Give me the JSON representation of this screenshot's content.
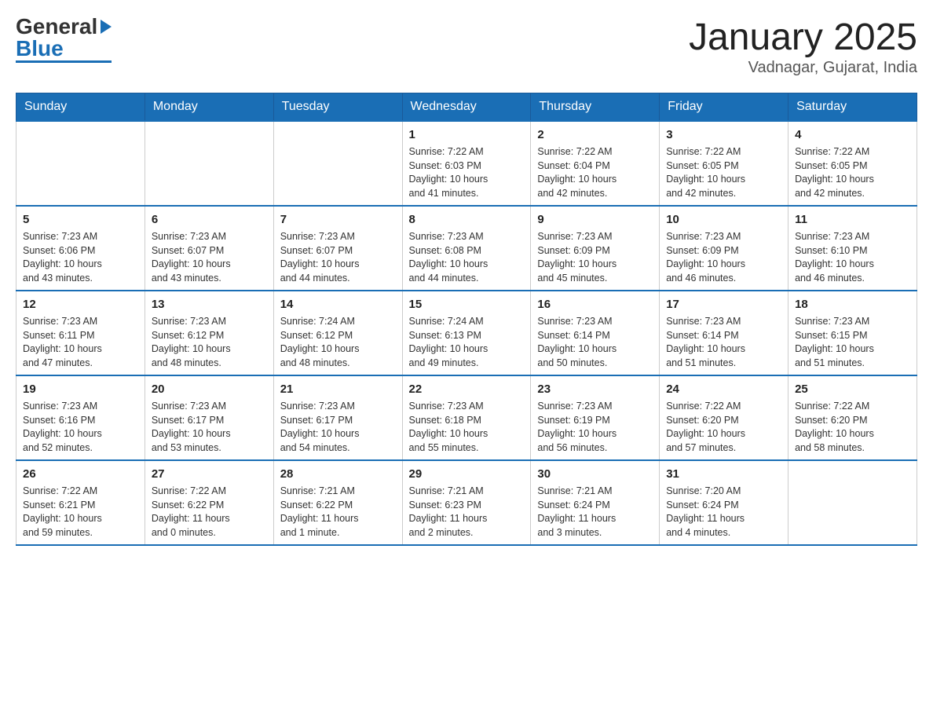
{
  "header": {
    "logo": {
      "general": "General",
      "blue": "Blue",
      "tagline": ""
    },
    "title": "January 2025",
    "location": "Vadnagar, Gujarat, India"
  },
  "calendar": {
    "days": [
      "Sunday",
      "Monday",
      "Tuesday",
      "Wednesday",
      "Thursday",
      "Friday",
      "Saturday"
    ],
    "weeks": [
      [
        {
          "num": "",
          "info": ""
        },
        {
          "num": "",
          "info": ""
        },
        {
          "num": "",
          "info": ""
        },
        {
          "num": "1",
          "info": "Sunrise: 7:22 AM\nSunset: 6:03 PM\nDaylight: 10 hours\nand 41 minutes."
        },
        {
          "num": "2",
          "info": "Sunrise: 7:22 AM\nSunset: 6:04 PM\nDaylight: 10 hours\nand 42 minutes."
        },
        {
          "num": "3",
          "info": "Sunrise: 7:22 AM\nSunset: 6:05 PM\nDaylight: 10 hours\nand 42 minutes."
        },
        {
          "num": "4",
          "info": "Sunrise: 7:22 AM\nSunset: 6:05 PM\nDaylight: 10 hours\nand 42 minutes."
        }
      ],
      [
        {
          "num": "5",
          "info": "Sunrise: 7:23 AM\nSunset: 6:06 PM\nDaylight: 10 hours\nand 43 minutes."
        },
        {
          "num": "6",
          "info": "Sunrise: 7:23 AM\nSunset: 6:07 PM\nDaylight: 10 hours\nand 43 minutes."
        },
        {
          "num": "7",
          "info": "Sunrise: 7:23 AM\nSunset: 6:07 PM\nDaylight: 10 hours\nand 44 minutes."
        },
        {
          "num": "8",
          "info": "Sunrise: 7:23 AM\nSunset: 6:08 PM\nDaylight: 10 hours\nand 44 minutes."
        },
        {
          "num": "9",
          "info": "Sunrise: 7:23 AM\nSunset: 6:09 PM\nDaylight: 10 hours\nand 45 minutes."
        },
        {
          "num": "10",
          "info": "Sunrise: 7:23 AM\nSunset: 6:09 PM\nDaylight: 10 hours\nand 46 minutes."
        },
        {
          "num": "11",
          "info": "Sunrise: 7:23 AM\nSunset: 6:10 PM\nDaylight: 10 hours\nand 46 minutes."
        }
      ],
      [
        {
          "num": "12",
          "info": "Sunrise: 7:23 AM\nSunset: 6:11 PM\nDaylight: 10 hours\nand 47 minutes."
        },
        {
          "num": "13",
          "info": "Sunrise: 7:23 AM\nSunset: 6:12 PM\nDaylight: 10 hours\nand 48 minutes."
        },
        {
          "num": "14",
          "info": "Sunrise: 7:24 AM\nSunset: 6:12 PM\nDaylight: 10 hours\nand 48 minutes."
        },
        {
          "num": "15",
          "info": "Sunrise: 7:24 AM\nSunset: 6:13 PM\nDaylight: 10 hours\nand 49 minutes."
        },
        {
          "num": "16",
          "info": "Sunrise: 7:23 AM\nSunset: 6:14 PM\nDaylight: 10 hours\nand 50 minutes."
        },
        {
          "num": "17",
          "info": "Sunrise: 7:23 AM\nSunset: 6:14 PM\nDaylight: 10 hours\nand 51 minutes."
        },
        {
          "num": "18",
          "info": "Sunrise: 7:23 AM\nSunset: 6:15 PM\nDaylight: 10 hours\nand 51 minutes."
        }
      ],
      [
        {
          "num": "19",
          "info": "Sunrise: 7:23 AM\nSunset: 6:16 PM\nDaylight: 10 hours\nand 52 minutes."
        },
        {
          "num": "20",
          "info": "Sunrise: 7:23 AM\nSunset: 6:17 PM\nDaylight: 10 hours\nand 53 minutes."
        },
        {
          "num": "21",
          "info": "Sunrise: 7:23 AM\nSunset: 6:17 PM\nDaylight: 10 hours\nand 54 minutes."
        },
        {
          "num": "22",
          "info": "Sunrise: 7:23 AM\nSunset: 6:18 PM\nDaylight: 10 hours\nand 55 minutes."
        },
        {
          "num": "23",
          "info": "Sunrise: 7:23 AM\nSunset: 6:19 PM\nDaylight: 10 hours\nand 56 minutes."
        },
        {
          "num": "24",
          "info": "Sunrise: 7:22 AM\nSunset: 6:20 PM\nDaylight: 10 hours\nand 57 minutes."
        },
        {
          "num": "25",
          "info": "Sunrise: 7:22 AM\nSunset: 6:20 PM\nDaylight: 10 hours\nand 58 minutes."
        }
      ],
      [
        {
          "num": "26",
          "info": "Sunrise: 7:22 AM\nSunset: 6:21 PM\nDaylight: 10 hours\nand 59 minutes."
        },
        {
          "num": "27",
          "info": "Sunrise: 7:22 AM\nSunset: 6:22 PM\nDaylight: 11 hours\nand 0 minutes."
        },
        {
          "num": "28",
          "info": "Sunrise: 7:21 AM\nSunset: 6:22 PM\nDaylight: 11 hours\nand 1 minute."
        },
        {
          "num": "29",
          "info": "Sunrise: 7:21 AM\nSunset: 6:23 PM\nDaylight: 11 hours\nand 2 minutes."
        },
        {
          "num": "30",
          "info": "Sunrise: 7:21 AM\nSunset: 6:24 PM\nDaylight: 11 hours\nand 3 minutes."
        },
        {
          "num": "31",
          "info": "Sunrise: 7:20 AM\nSunset: 6:24 PM\nDaylight: 11 hours\nand 4 minutes."
        },
        {
          "num": "",
          "info": ""
        }
      ]
    ]
  }
}
